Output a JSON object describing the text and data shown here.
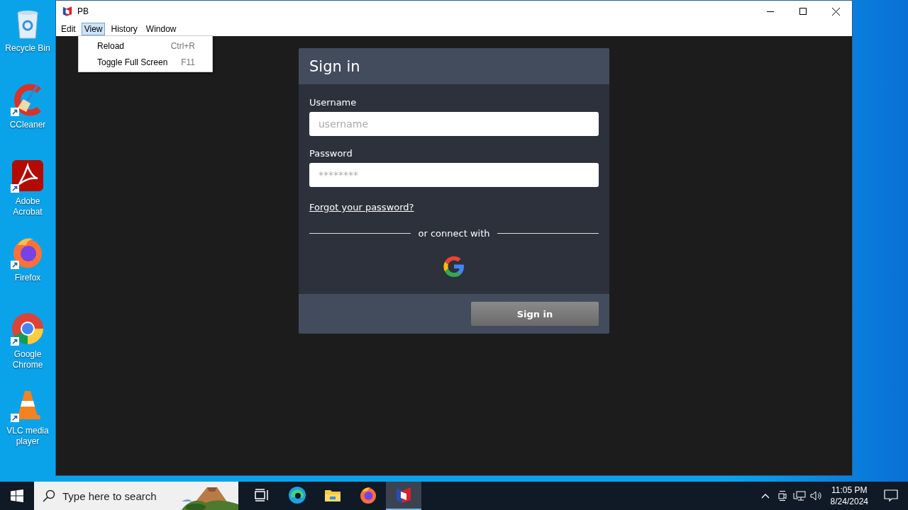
{
  "desktop_icons": [
    {
      "kind": "recycle",
      "label": "Recycle Bin",
      "shortcut": false
    },
    {
      "kind": "ccleaner",
      "label": "CCleaner",
      "shortcut": true
    },
    {
      "kind": "acrobat",
      "label": "Adobe Acrobat",
      "shortcut": true
    },
    {
      "kind": "firefox",
      "label": "Firefox",
      "shortcut": true
    },
    {
      "kind": "chrome",
      "label": "Google Chrome",
      "shortcut": true
    },
    {
      "kind": "vlc",
      "label": "VLC media player",
      "shortcut": true
    }
  ],
  "window": {
    "title": "PB",
    "menu": [
      {
        "label": "Edit",
        "selected": false
      },
      {
        "label": "View",
        "selected": true
      },
      {
        "label": "History",
        "selected": false
      },
      {
        "label": "Window",
        "selected": false
      }
    ],
    "dropdown": [
      {
        "label": "Reload",
        "shortcut": "Ctrl+R"
      },
      {
        "label": "Toggle Full Screen",
        "shortcut": "F11"
      }
    ]
  },
  "sign_in": {
    "title": "Sign in",
    "username_label": "Username",
    "username_placeholder": "username",
    "password_label": "Password",
    "password_placeholder": "********",
    "forgot_link": "Forgot your password?",
    "divider_text": "or connect with",
    "submit": "Sign in"
  },
  "taskbar": {
    "search_placeholder": "Type here to search",
    "apps": [
      {
        "kind": "taskview",
        "active": false
      },
      {
        "kind": "edge",
        "active": false
      },
      {
        "kind": "explorer",
        "active": false
      },
      {
        "kind": "firefox",
        "active": false
      },
      {
        "kind": "pb",
        "active": true
      }
    ],
    "time": "11:05 PM",
    "date": "8/24/2024"
  }
}
